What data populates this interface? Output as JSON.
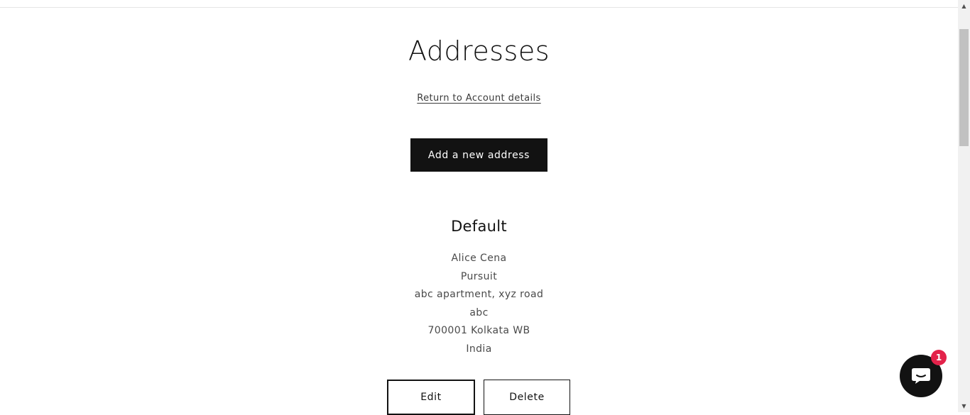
{
  "page": {
    "title": "Addresses",
    "return_link": "Return to Account details",
    "add_button": "Add a new address"
  },
  "address": {
    "heading": "Default",
    "lines": [
      "Alice Cena",
      "Pursuit",
      "abc apartment, xyz road",
      "abc",
      "700001 Kolkata WB",
      "India"
    ],
    "edit_label": "Edit",
    "delete_label": "Delete"
  },
  "chat": {
    "badge_count": "1",
    "icon": "chat-bubble-icon"
  },
  "scrollbar": {
    "up_icon": "▲",
    "down_icon": "▼"
  },
  "colors": {
    "primary": "#121212",
    "badge": "#e3224a"
  }
}
